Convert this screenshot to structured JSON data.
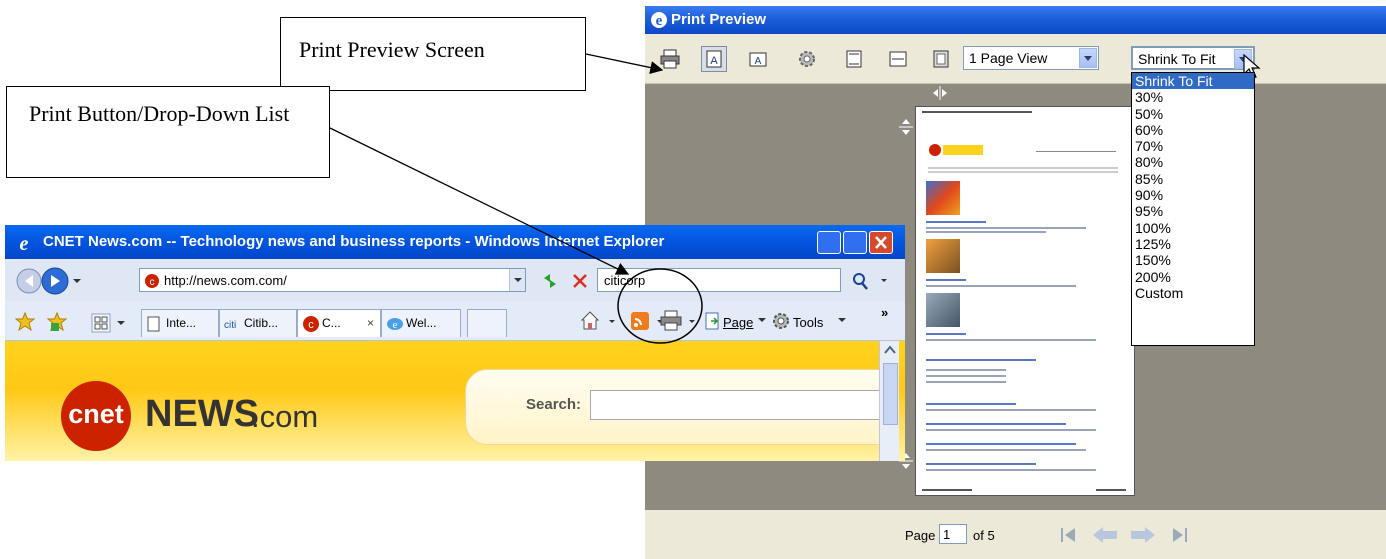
{
  "callouts": {
    "print_preview": "Print Preview Screen",
    "print_button": "Print Button/Drop-Down List"
  },
  "print_preview": {
    "title": "Print Preview",
    "view_select": "1 Page View",
    "zoom_select": "Shrink To Fit",
    "zoom_options": [
      "Shrink To Fit",
      "30%",
      "50%",
      "60%",
      "70%",
      "80%",
      "85%",
      "90%",
      "95%",
      "100%",
      "125%",
      "150%",
      "200%",
      "Custom"
    ],
    "zoom_selected_index": 0,
    "status": {
      "page_label": "Page",
      "page_value": "1",
      "of_label": "of 5"
    }
  },
  "browser": {
    "title": "CNET News.com -- Technology news and business reports - Windows Internet Explorer",
    "address": "http://news.com.com/",
    "search_value": "citicorp",
    "tabs": [
      "Inte...",
      "Citib...",
      "C...",
      "Wel..."
    ],
    "commands": {
      "page": "Page",
      "tools": "Tools"
    },
    "site": {
      "logo": "cnet",
      "news": "NEWS",
      "dotcom": ".com",
      "search_label": "Search:"
    }
  },
  "colors": {
    "titlebar_blue": "#0454e0",
    "cnet_red": "#cc2200",
    "selection": "#316ac5"
  }
}
